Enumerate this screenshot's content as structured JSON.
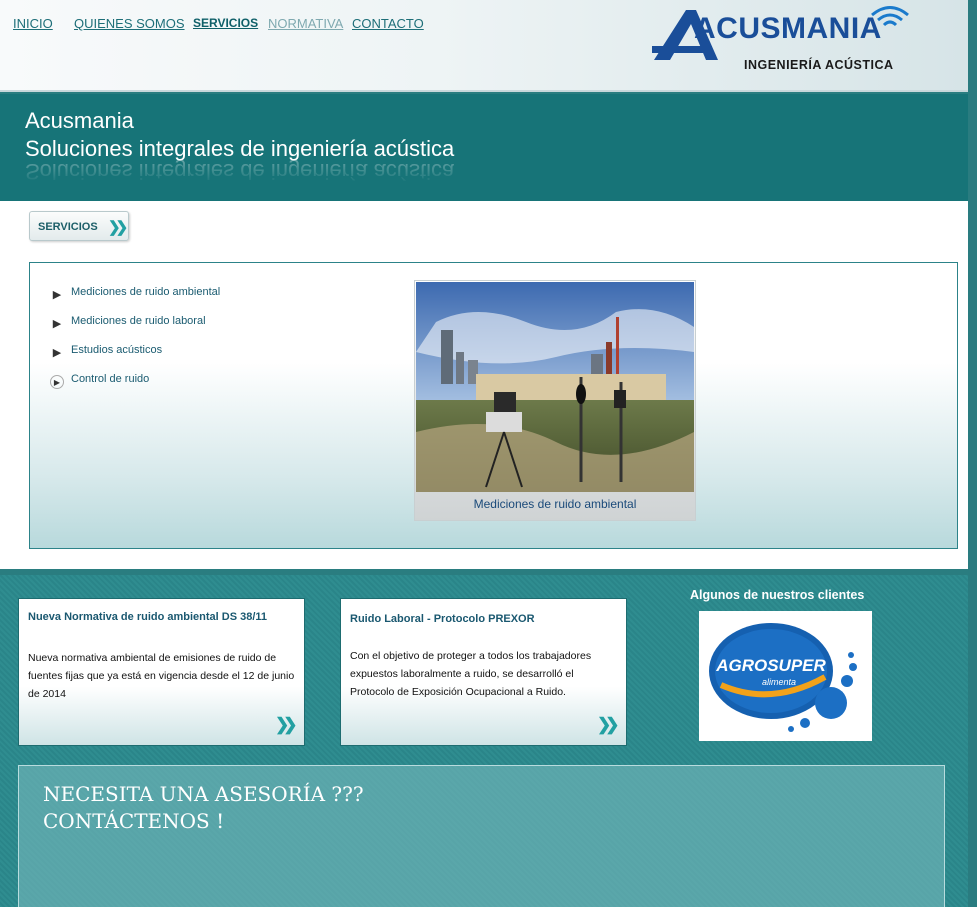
{
  "nav": {
    "items": [
      {
        "label": "INICIO"
      },
      {
        "label": "QUIENES SOMOS"
      },
      {
        "label": "SERVICIOS"
      },
      {
        "label": "NORMATIVA"
      },
      {
        "label": "CONTACTO"
      }
    ]
  },
  "logo": {
    "name": "ACUSMANIA",
    "tagline": "INGENIERÍA ACÚSTICA",
    "icon": "wifi-signal-icon",
    "brand_color": "#1a4e99"
  },
  "banner": {
    "title": "Acusmania",
    "subtitle": "Soluciones integrales de ingeniería acústica"
  },
  "services": {
    "tab_label": "SERVICIOS",
    "items": [
      {
        "label": "Mediciones de ruido ambiental"
      },
      {
        "label": "Mediciones de ruido laboral"
      },
      {
        "label": "Estudios acústicos"
      },
      {
        "label": "Control de ruido"
      }
    ],
    "feature_caption": "Mediciones de ruido ambiental"
  },
  "news": [
    {
      "title": "Nueva Normativa de ruido ambiental DS 38/11",
      "body": "Nueva normativa ambiental de emisiones de ruido de fuentes fijas que ya está en vigencia desde el 12 de junio de 2014"
    },
    {
      "title": "Ruido Laboral - Protocolo PREXOR",
      "body": "Con el objetivo de proteger a todos los trabajadores expuestos laboralmente a ruido, se desarrolló el Protocolo de Exposición Ocupacional a Ruido."
    }
  ],
  "clients": {
    "title": "Algunos de nuestros clientes",
    "logo_name": "AGROSUPER",
    "logo_tagline": "alimenta"
  },
  "cta": {
    "line1": "NECESITA UNA ASESORÍA ???",
    "line2": "CONTÁCTENOS !"
  },
  "colors": {
    "teal_banner": "#177478",
    "teal_bg": "#2a7d80",
    "accent_arrows": "#22a0a2"
  }
}
